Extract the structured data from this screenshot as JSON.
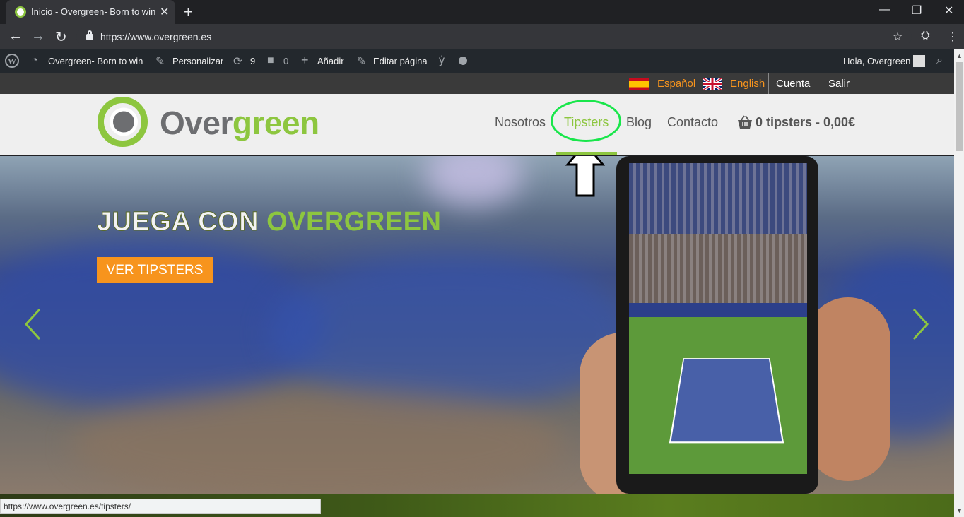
{
  "browser": {
    "tab_title": "Inicio - Overgreen- Born to win",
    "url": "https://www.overgreen.es",
    "status_url": "https://www.overgreen.es/tipsters/"
  },
  "wpbar": {
    "site_name": "Overgreen- Born to win",
    "customize": "Personalizar",
    "updates_count": "9",
    "comments_count": "0",
    "add_new": "Añadir",
    "edit_page": "Editar página",
    "greeting": "Hola, Overgreen"
  },
  "langbar": {
    "spanish": "Español",
    "english": "English",
    "account": "Cuenta",
    "logout": "Salir"
  },
  "header": {
    "logo_part1": "Over",
    "logo_part2": "green",
    "menu": {
      "about": "Nosotros",
      "tipsters": "Tipsters",
      "blog": "Blog",
      "contact": "Contacto",
      "cart": "0 tipsters - 0,00€"
    }
  },
  "hero": {
    "title_part1": "JUEGA CON",
    "title_part2": "OVERGREEN",
    "button": "VER TIPSTERS"
  },
  "colors": {
    "brand_green": "#8dc63f",
    "orange": "#f7941d",
    "annotation_green": "#19e64b"
  }
}
